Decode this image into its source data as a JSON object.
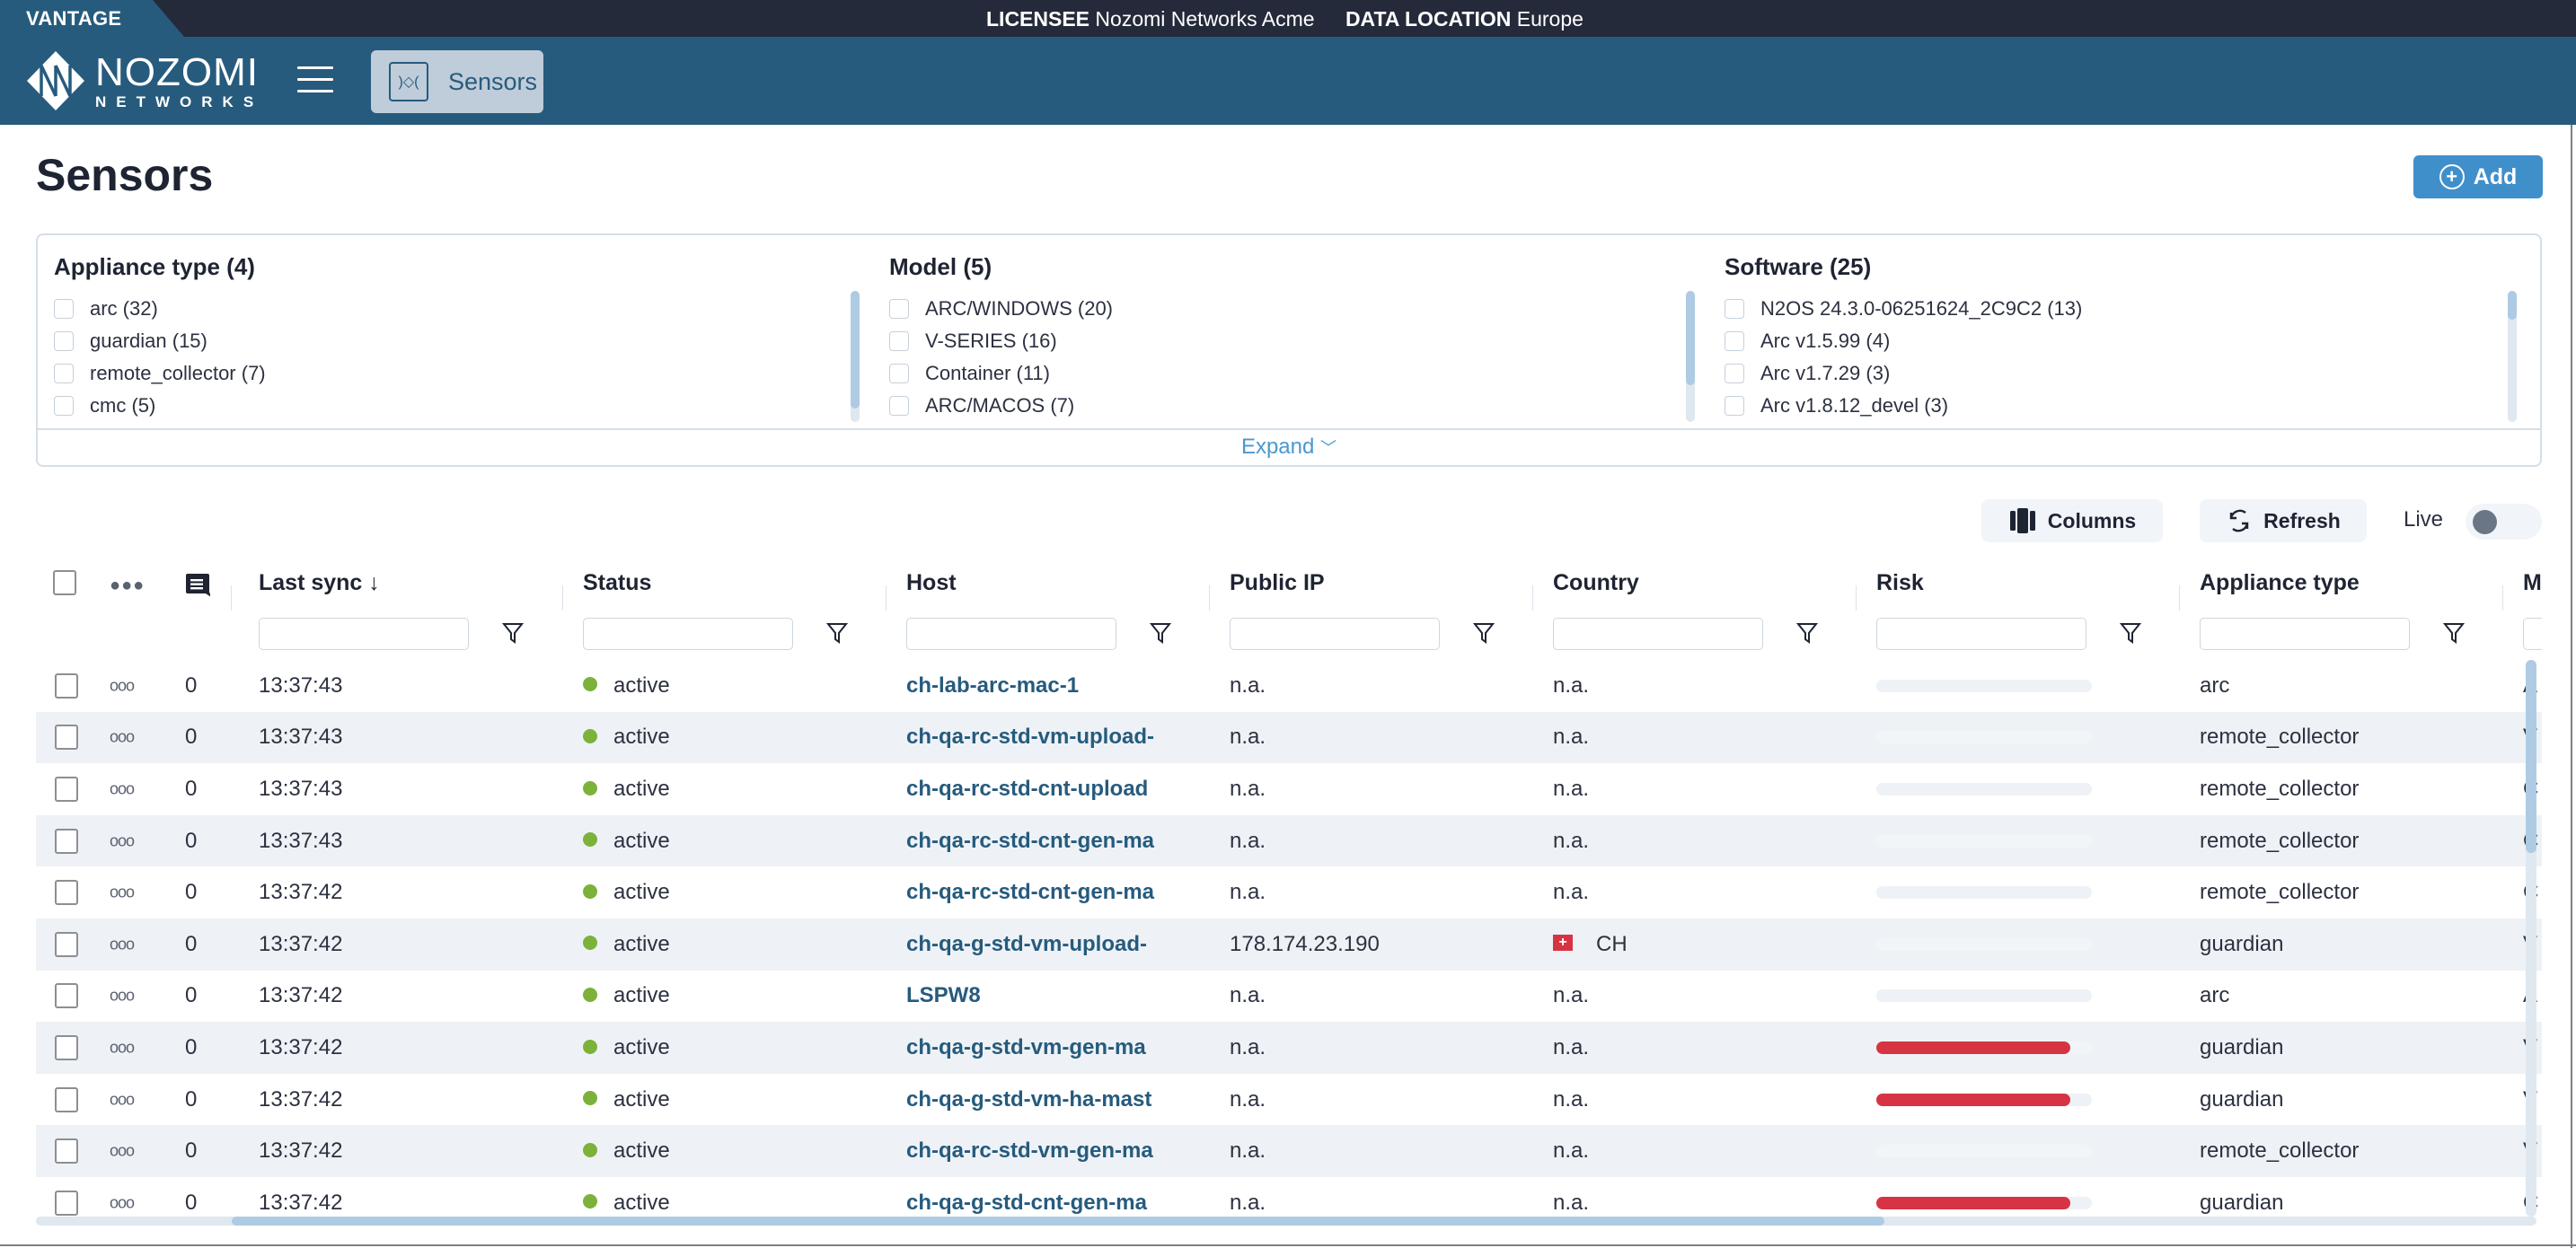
{
  "topbar": {
    "product": "VANTAGE",
    "licensee_label": "LICENSEE",
    "licensee_value": "Nozomi Networks Acme",
    "data_location_label": "DATA LOCATION",
    "data_location_value": "Europe"
  },
  "nav": {
    "logo_line1": "NOZOMI",
    "logo_line2": "NETWORKS",
    "menu_icon": "hamburger-icon",
    "active_section": {
      "label": "Sensors",
      "icon": "sensor-icon"
    }
  },
  "page": {
    "title": "Sensors",
    "add_label": "Add"
  },
  "facets": {
    "expand_label": "Expand",
    "groups": [
      {
        "title": "Appliance type (4)",
        "items": [
          "arc (32)",
          "guardian (15)",
          "remote_collector (7)",
          "cmc (5)"
        ],
        "scroll_fraction": 0.9
      },
      {
        "title": "Model (5)",
        "items": [
          "ARC/WINDOWS (20)",
          "V-SERIES (16)",
          "Container (11)",
          "ARC/MACOS (7)"
        ],
        "scroll_fraction": 0.72
      },
      {
        "title": "Software (25)",
        "items": [
          "N2OS 24.3.0-06251624_2C9C2 (13)",
          "Arc v1.5.99 (4)",
          "Arc v1.7.29 (3)",
          "Arc v1.8.12_devel (3)"
        ],
        "scroll_fraction": 0.22
      }
    ]
  },
  "toolbar": {
    "columns_label": "Columns",
    "refresh_label": "Refresh",
    "live_label": "Live",
    "live_on": false
  },
  "table": {
    "sort": {
      "column": "Last sync",
      "direction": "desc"
    },
    "columns": [
      "Last sync",
      "Status",
      "Host",
      "Public IP",
      "Country",
      "Risk",
      "Appliance type",
      "M"
    ],
    "filters": [
      "",
      "",
      "",
      "",
      "",
      "",
      "",
      ""
    ],
    "rows": [
      {
        "comments": "0",
        "last_sync": "13:37:43",
        "status": "active",
        "host": "ch-lab-arc-mac-1",
        "public_ip": "n.a.",
        "country": "n.a.",
        "country_flag": "",
        "risk": 0,
        "appliance_type": "arc",
        "model": "A"
      },
      {
        "comments": "0",
        "last_sync": "13:37:43",
        "status": "active",
        "host": "ch-qa-rc-std-vm-upload-",
        "public_ip": "n.a.",
        "country": "n.a.",
        "country_flag": "",
        "risk": 0,
        "appliance_type": "remote_collector",
        "model": "V"
      },
      {
        "comments": "0",
        "last_sync": "13:37:43",
        "status": "active",
        "host": "ch-qa-rc-std-cnt-upload",
        "public_ip": "n.a.",
        "country": "n.a.",
        "country_flag": "",
        "risk": 0,
        "appliance_type": "remote_collector",
        "model": "C"
      },
      {
        "comments": "0",
        "last_sync": "13:37:43",
        "status": "active",
        "host": "ch-qa-rc-std-cnt-gen-ma",
        "public_ip": "n.a.",
        "country": "n.a.",
        "country_flag": "",
        "risk": 0,
        "appliance_type": "remote_collector",
        "model": "C"
      },
      {
        "comments": "0",
        "last_sync": "13:37:42",
        "status": "active",
        "host": "ch-qa-rc-std-cnt-gen-ma",
        "public_ip": "n.a.",
        "country": "n.a.",
        "country_flag": "",
        "risk": 0,
        "appliance_type": "remote_collector",
        "model": "C"
      },
      {
        "comments": "0",
        "last_sync": "13:37:42",
        "status": "active",
        "host": "ch-qa-g-std-vm-upload-",
        "public_ip": "178.174.23.190",
        "country": "CH",
        "country_flag": "+",
        "risk": 0,
        "appliance_type": "guardian",
        "model": "V"
      },
      {
        "comments": "0",
        "last_sync": "13:37:42",
        "status": "active",
        "host": "LSPW8",
        "public_ip": "n.a.",
        "country": "n.a.",
        "country_flag": "",
        "risk": 0,
        "appliance_type": "arc",
        "model": "A"
      },
      {
        "comments": "0",
        "last_sync": "13:37:42",
        "status": "active",
        "host": "ch-qa-g-std-vm-gen-ma",
        "public_ip": "n.a.",
        "country": "n.a.",
        "country_flag": "",
        "risk": 0.9,
        "appliance_type": "guardian",
        "model": "V"
      },
      {
        "comments": "0",
        "last_sync": "13:37:42",
        "status": "active",
        "host": "ch-qa-g-std-vm-ha-mast",
        "public_ip": "n.a.",
        "country": "n.a.",
        "country_flag": "",
        "risk": 0.9,
        "appliance_type": "guardian",
        "model": "V"
      },
      {
        "comments": "0",
        "last_sync": "13:37:42",
        "status": "active",
        "host": "ch-qa-rc-std-vm-gen-ma",
        "public_ip": "n.a.",
        "country": "n.a.",
        "country_flag": "",
        "risk": 0,
        "appliance_type": "remote_collector",
        "model": "V"
      },
      {
        "comments": "0",
        "last_sync": "13:37:42",
        "status": "active",
        "host": "ch-qa-g-std-cnt-gen-ma",
        "public_ip": "n.a.",
        "country": "n.a.",
        "country_flag": "",
        "risk": 0.9,
        "appliance_type": "guardian",
        "model": "C"
      }
    ]
  },
  "colors": {
    "brand": "#265b7d",
    "topstrip": "#252a3a",
    "accent": "#3f8fcb",
    "status_active": "#7cb23a",
    "risk_high": "#d63443"
  }
}
